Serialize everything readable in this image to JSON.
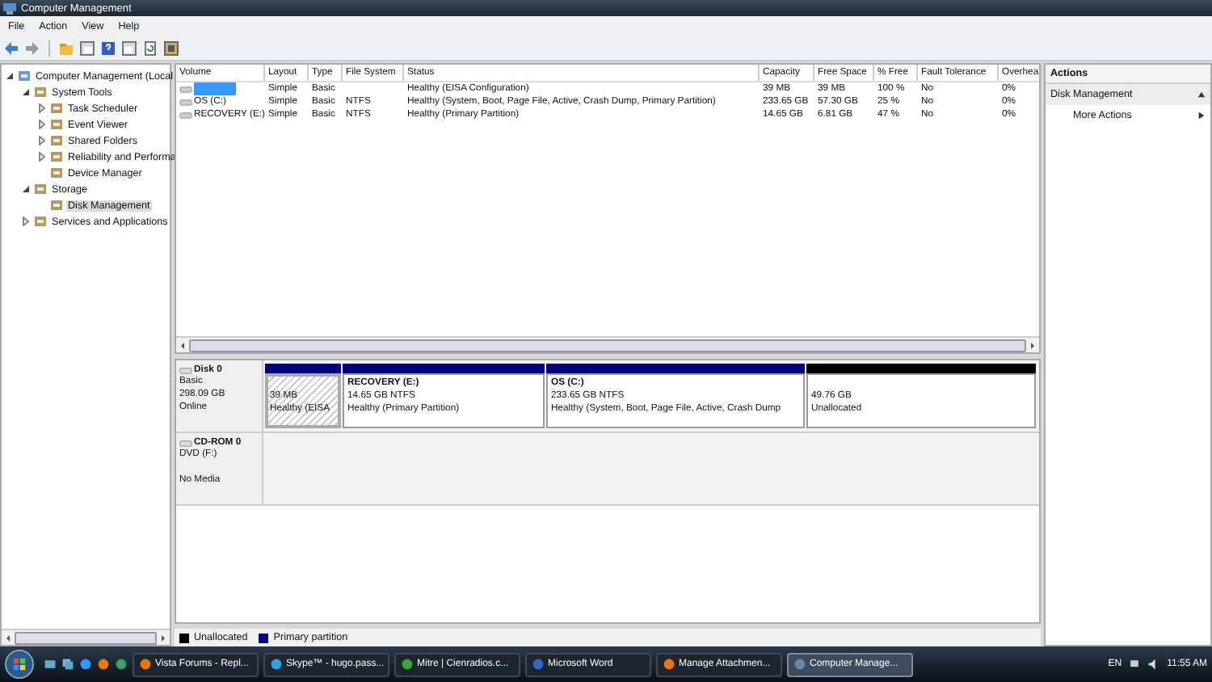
{
  "window": {
    "title": "Computer Management"
  },
  "menu": [
    "File",
    "Action",
    "View",
    "Help"
  ],
  "tree": [
    {
      "label": "Computer Management (Local",
      "kind": "node",
      "expanded": true,
      "selected": false,
      "children": [
        {
          "label": "System Tools",
          "kind": "node",
          "expanded": true,
          "selected": false,
          "children": [
            {
              "label": "Task Scheduler",
              "kind": "node",
              "expanded": false,
              "selected": false
            },
            {
              "label": "Event Viewer",
              "kind": "node",
              "expanded": false,
              "selected": false
            },
            {
              "label": "Shared Folders",
              "kind": "node",
              "expanded": false,
              "selected": false
            },
            {
              "label": "Reliability and Performa",
              "kind": "node",
              "expanded": false,
              "selected": false
            },
            {
              "label": "Device Manager",
              "kind": "leaf",
              "selected": false
            }
          ]
        },
        {
          "label": "Storage",
          "kind": "node",
          "expanded": true,
          "selected": false,
          "children": [
            {
              "label": "Disk Management",
              "kind": "leaf",
              "selected": true
            }
          ]
        },
        {
          "label": "Services and Applications",
          "kind": "node",
          "expanded": false,
          "selected": false
        }
      ]
    }
  ],
  "table": {
    "columns": [
      "Volume",
      "Layout",
      "Type",
      "File System",
      "Status",
      "Capacity",
      "Free Space",
      "% Free",
      "Fault Tolerance",
      "Overhea"
    ],
    "rows": [
      {
        "selected": true,
        "cells": [
          "",
          "Simple",
          "Basic",
          "",
          "Healthy (EISA Configuration)",
          "39 MB",
          "39 MB",
          "100 %",
          "No",
          "0%"
        ]
      },
      {
        "selected": false,
        "cells": [
          "OS (C:)",
          "Simple",
          "Basic",
          "NTFS",
          "Healthy (System, Boot, Page File, Active, Crash Dump, Primary Partition)",
          "233.65 GB",
          "57.30 GB",
          "25 %",
          "No",
          "0%"
        ]
      },
      {
        "selected": false,
        "cells": [
          "RECOVERY (E:)",
          "Simple",
          "Basic",
          "NTFS",
          "Healthy (Primary Partition)",
          "14.65 GB",
          "6.81 GB",
          "47 %",
          "No",
          "0%"
        ]
      }
    ]
  },
  "disks": [
    {
      "name": "Disk 0",
      "lines": [
        "Basic",
        "298.09 GB",
        "Online"
      ],
      "partitions": [
        {
          "color": "#000080",
          "selected": true,
          "lines": [
            "39 MB",
            "Healthy (EISA"
          ]
        },
        {
          "color": "#000080",
          "selected": false,
          "title": "RECOVERY  (E:)",
          "lines": [
            "14.65 GB NTFS",
            "Healthy (Primary Partition)"
          ]
        },
        {
          "color": "#000080",
          "selected": false,
          "title": "OS  (C:)",
          "lines": [
            "233.65 GB NTFS",
            "Healthy (System, Boot, Page File, Active, Crash Dump"
          ]
        },
        {
          "color": "#000000",
          "selected": false,
          "lines": [
            "49.76 GB",
            "Unallocated"
          ]
        }
      ]
    },
    {
      "name": "CD-ROM 0",
      "lines": [
        "DVD (F:)",
        "No Media"
      ]
    }
  ],
  "legend": [
    {
      "label": "Unallocated",
      "color": "#000000"
    },
    {
      "label": "Primary partition",
      "color": "#000080"
    }
  ],
  "actions": {
    "title": "Actions",
    "section": "Disk Management",
    "items": [
      "More Actions"
    ]
  },
  "taskbar": {
    "tasks": [
      {
        "label": "Vista Forums - Repl...",
        "selected": false
      },
      {
        "label": "Skype™ - hugo.pass...",
        "selected": false
      },
      {
        "label": "Mitre | Cienradios.c...",
        "selected": false
      },
      {
        "label": "Microsoft Word",
        "selected": false
      },
      {
        "label": "Manage Attachmen...",
        "selected": false
      },
      {
        "label": "Computer Manage...",
        "selected": true
      }
    ],
    "language": "EN",
    "time": "11:55 AM"
  }
}
